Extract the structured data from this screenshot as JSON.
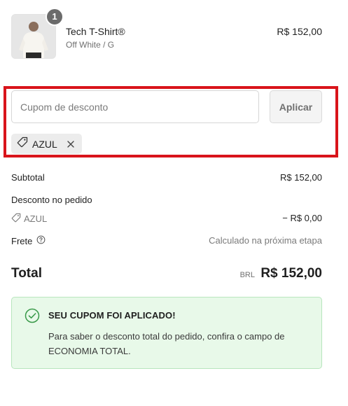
{
  "product": {
    "quantity": "1",
    "name": "Tech T-Shirt®",
    "variant": "Off White / G",
    "price": "R$ 152,00"
  },
  "coupon": {
    "placeholder": "Cupom de desconto",
    "value": "",
    "apply_label": "Aplicar",
    "applied_code": "AZUL"
  },
  "summary": {
    "subtotal_label": "Subtotal",
    "subtotal_value": "R$ 152,00",
    "discount_label": "Desconto no pedido",
    "discount_code": "AZUL",
    "discount_value": "− R$ 0,00",
    "shipping_label": "Frete",
    "shipping_value": "Calculado na próxima etapa"
  },
  "total": {
    "label": "Total",
    "currency": "BRL",
    "value": "R$ 152,00"
  },
  "notice": {
    "title": "SEU CUPOM FOI APLICADO!",
    "text": "Para saber o desconto total do pedido, confira o campo de ECONOMIA TOTAL."
  },
  "colors": {
    "highlight": "#d9141b",
    "success_bg": "#e8f9e9",
    "success_border": "#b8e6bd",
    "success_icon": "#3a9a4a"
  },
  "icons": [
    "tag-icon",
    "close-icon",
    "help-circle-icon",
    "check-circle-icon"
  ]
}
